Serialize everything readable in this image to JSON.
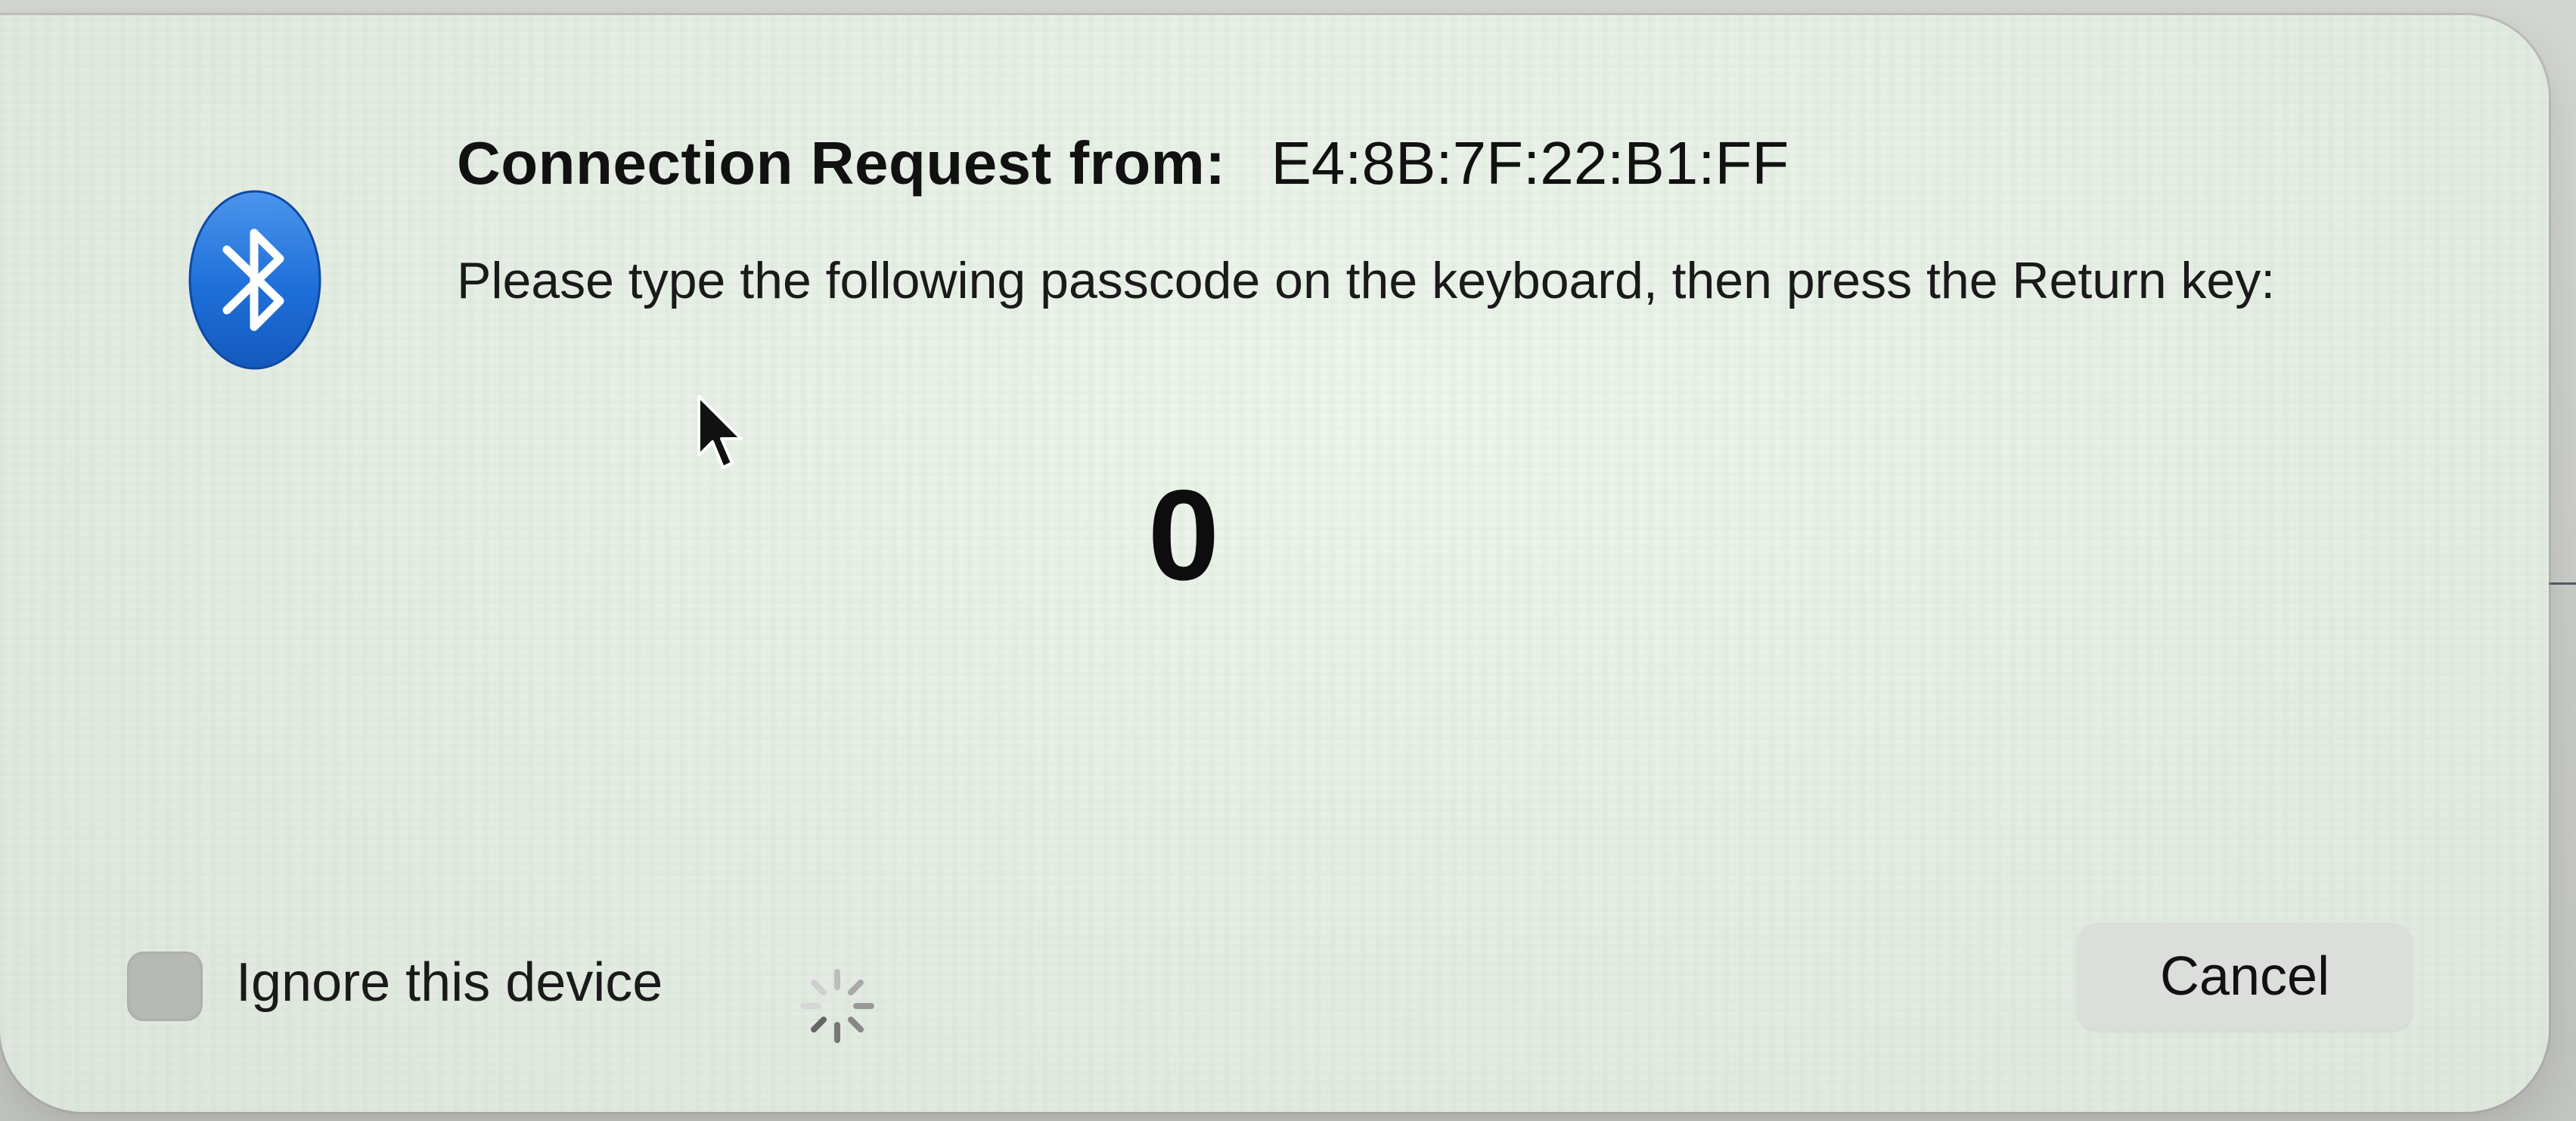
{
  "dialog": {
    "title_label": "Connection Request from:",
    "device_address": "E4:8B:7F:22:B1:FF",
    "message": "Please type the following passcode on the keyboard, then press the Return key:",
    "passcode": "0",
    "icon": "bluetooth-icon",
    "accent_color": "#1e6fd9"
  },
  "footer": {
    "ignore_checkbox_checked": false,
    "ignore_label": "Ignore this device",
    "spinner_icon": "loading-spinner-icon",
    "cancel_label": "Cancel"
  }
}
